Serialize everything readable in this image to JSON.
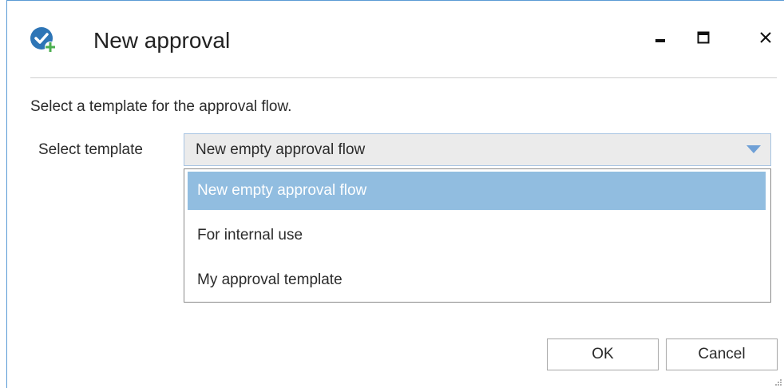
{
  "window": {
    "title": "New approval",
    "icons": {
      "app": "approval-check-icon",
      "minimize": "minimize-icon",
      "maximize": "maximize-icon",
      "close": "close-icon"
    }
  },
  "instruction": "Select a template for the approval flow.",
  "template_select": {
    "label": "Select template",
    "value": "New empty approval flow",
    "options": [
      "New empty approval flow",
      "For internal use",
      "My approval template"
    ],
    "selected_index": 0
  },
  "buttons": {
    "ok": "OK",
    "cancel": "Cancel"
  },
  "colors": {
    "accent": "#5b9bd5",
    "selected_option": "#91bde0",
    "dropdown_arrow": "#6fa0d6",
    "icon_blue": "#2e75b6",
    "icon_green": "#4caf50"
  }
}
